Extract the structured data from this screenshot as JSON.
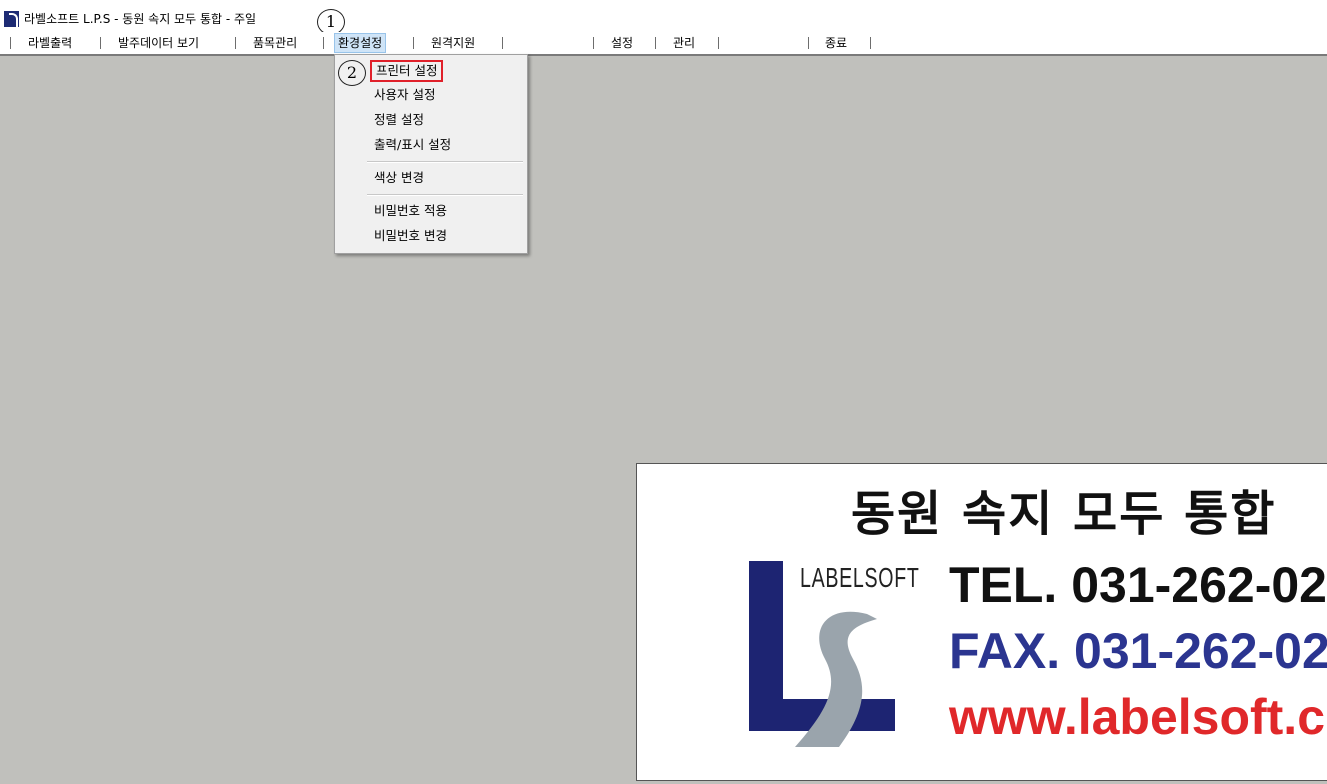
{
  "window": {
    "title": "라벨소프트 L.P.S - 동원 속지 모두 통합 - 주일"
  },
  "annotations": {
    "step1": "1",
    "step2": "2"
  },
  "menubar": {
    "items": [
      {
        "label": "라벨출력"
      },
      {
        "label": "발주데이터 보기"
      },
      {
        "label": "품목관리"
      },
      {
        "label": "환경설정"
      },
      {
        "label": "원격지원"
      },
      {
        "label": ""
      },
      {
        "label": "설정"
      },
      {
        "label": "관리"
      },
      {
        "label": ""
      },
      {
        "label": "종료"
      }
    ]
  },
  "dropdown": {
    "items": [
      {
        "label": "프린터 설정"
      },
      {
        "label": "사용자 설정"
      },
      {
        "label": "정렬 설정"
      },
      {
        "label": "출력/표시 설정"
      },
      {
        "label": "색상 변경"
      },
      {
        "label": "비밀번호 적용"
      },
      {
        "label": "비밀번호 변경"
      }
    ]
  },
  "banner": {
    "title": "동원 속지 모두 통합",
    "logo_text": "LABELSOFT",
    "tel": "TEL. 031-262-02",
    "fax": "FAX. 031-262-02",
    "web": "www.labelsoft.c",
    "colors": {
      "logo_navy": "#1d2472",
      "logo_silver": "#9aa4ac",
      "tel": "#111111",
      "fax": "#2b3590",
      "web": "#e0282a"
    }
  }
}
